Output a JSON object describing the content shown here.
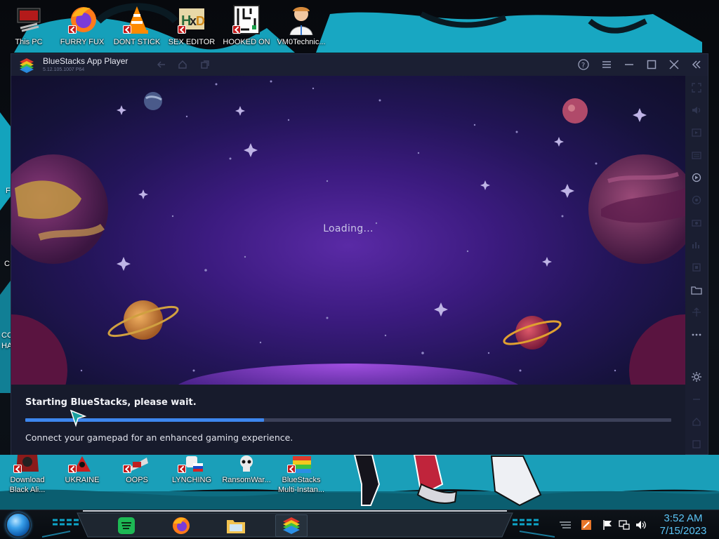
{
  "desktop": {
    "top_icons": [
      {
        "label": "This PC",
        "icon": "computer-icon"
      },
      {
        "label": "FURRY FUX",
        "icon": "firefox-icon"
      },
      {
        "label": "DONT STICK",
        "icon": "vlc-icon"
      },
      {
        "label": "SEX EDITOR",
        "icon": "hxd-icon"
      },
      {
        "label": "HOOKED ON",
        "icon": "maze-icon"
      },
      {
        "label": "VM0Technic...",
        "icon": "doctor-icon"
      }
    ],
    "bottom_icons": [
      {
        "label_line1": "Download",
        "label_line2": "Black Ali...",
        "icon": "app-icon"
      },
      {
        "label_line1": "UKRAINE",
        "label_line2": "",
        "icon": "app-icon"
      },
      {
        "label_line1": "OOPS",
        "label_line2": "",
        "icon": "app-icon"
      },
      {
        "label_line1": "LYNCHING",
        "label_line2": "",
        "icon": "app-icon"
      },
      {
        "label_line1": "RansomWar...",
        "label_line2": "",
        "icon": "skull-icon"
      },
      {
        "label_line1": "BlueStacks",
        "label_line2": "Multi-Instan...",
        "icon": "bluestacks-icon"
      }
    ],
    "left_edge_fragments": [
      "F",
      "C",
      "CC",
      "HA"
    ]
  },
  "window": {
    "title": "BlueStacks App Player",
    "version": "5.12.105.1007  P64",
    "loading_text": "Loading...",
    "status_text": "Starting BlueStacks, please wait.",
    "progress": 0.37,
    "gamepad_text": "Connect your gamepad for an enhanced gaming experience.",
    "titlebar_icons": [
      "back-icon",
      "home-icon",
      "multitask-icon",
      "help-icon",
      "menu-icon",
      "minimize-icon",
      "maximize-icon",
      "close-icon",
      "collapse-sidebar-icon"
    ],
    "sidebar_icons": [
      "fullscreen-icon",
      "volume-icon",
      "media-icon",
      "keyboard-icon",
      "rotate-icon",
      "record-icon",
      "camera-icon",
      "stats-icon",
      "screenshot-icon",
      "folder-icon",
      "shake-icon",
      "more-icon",
      "settings-icon",
      "back-icon",
      "home-icon",
      "recents-icon"
    ],
    "colors": {
      "accent": "#3d86ee",
      "panel": "#171b2c",
      "sidebar": "#1a1e31"
    }
  },
  "taskbar": {
    "apps": [
      "spotify-icon",
      "firefox-icon",
      "file-explorer-icon",
      "bluestacks-icon"
    ],
    "tray_icons": [
      "bars-icon",
      "tool-icon",
      "flag-icon",
      "network-icon",
      "volume-icon"
    ],
    "time": "3:52 AM",
    "date": "7/15/2023"
  }
}
